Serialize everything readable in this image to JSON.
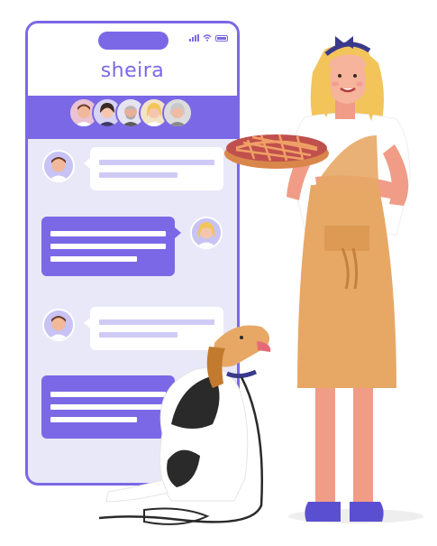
{
  "app": {
    "brand": "sheira"
  },
  "colors": {
    "accent": "#7b68e6",
    "light": "#e9e8f8",
    "apron": "#e7a866",
    "pie": "#c0504d",
    "hair": "#f2c45a"
  },
  "icons": [
    "signal-icon",
    "wifi-icon",
    "battery-icon"
  ]
}
